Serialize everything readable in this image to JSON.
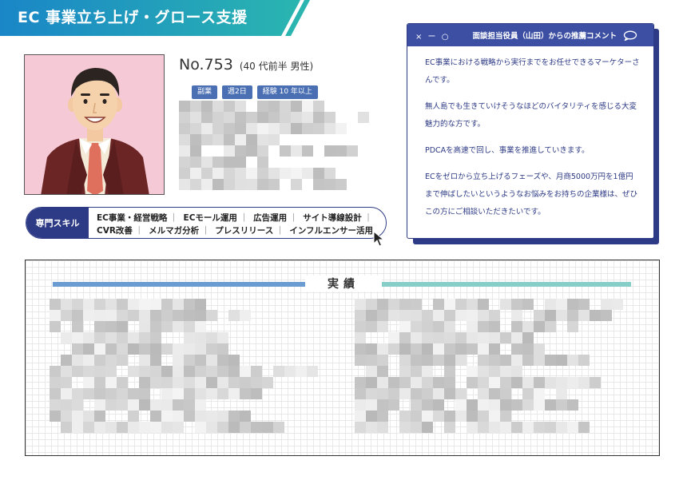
{
  "banner": {
    "title": "EC 事業立ち上げ・グロース支援",
    "colors": {
      "start": "#1a86c7",
      "end": "#2ab5b0"
    }
  },
  "profile": {
    "number": "No.753",
    "meta": "(40 代前半 男性)",
    "tags": [
      "副業",
      "週2日",
      "経験 10 年以上"
    ]
  },
  "skills": {
    "label": "専門スキル",
    "row1": [
      "EC事業・経営戦略",
      "ECモール運用",
      "広告運用",
      "サイト導線設計"
    ],
    "row2": [
      "CVR改善",
      "メルマガ分析",
      "プレスリリース",
      "インフルエンサー活用"
    ]
  },
  "comment_window": {
    "controls": "× ー ○",
    "title": "面談担当役員（山田）からの推薦コメント",
    "paragraphs": [
      "EC事業における戦略から実行までをお任せできるマーケターさんです。",
      "無人島でも生きていけそうなほどのバイタリティを感じる大変魅力的な方です。",
      "PDCAを高速で回し、事業を推進していきます。",
      "ECをゼロから立ち上げるフェーズや、月商5000万円を1億円まで伸ばしたいというようなお悩みをお持ちの企業様は、ぜひこの方にご相談いただきたいです。"
    ]
  },
  "achievements": {
    "title": "実績"
  },
  "icons": {
    "avatar": "businessman-avatar",
    "cursor": "mouse-pointer-icon",
    "comment": "speech-bubble-icon"
  },
  "colors": {
    "navy": "#2d3a85",
    "tag_blue": "#4a6fb3",
    "photo_bg": "#f6c9d6",
    "line_left": "#6a9bd1",
    "line_right": "#86cfc9"
  }
}
